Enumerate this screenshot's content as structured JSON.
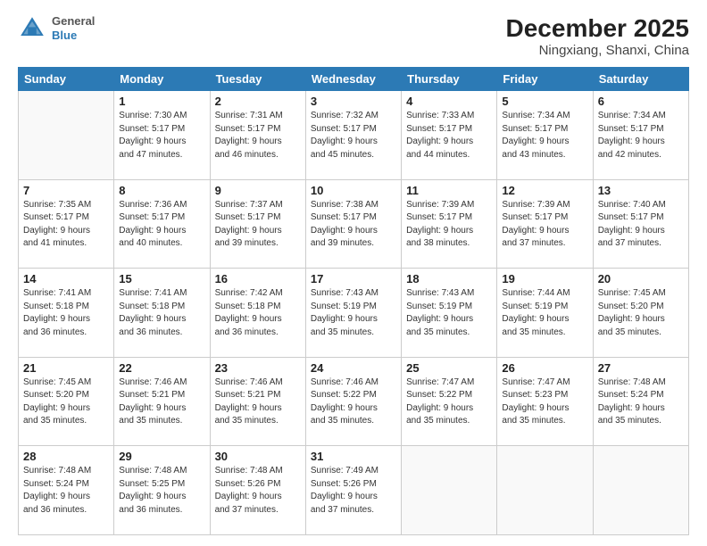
{
  "header": {
    "logo_line1": "General",
    "logo_line2": "Blue",
    "title": "December 2025",
    "subtitle": "Ningxiang, Shanxi, China"
  },
  "weekdays": [
    "Sunday",
    "Monday",
    "Tuesday",
    "Wednesday",
    "Thursday",
    "Friday",
    "Saturday"
  ],
  "weeks": [
    [
      {
        "day": "",
        "info": ""
      },
      {
        "day": "1",
        "info": "Sunrise: 7:30 AM\nSunset: 5:17 PM\nDaylight: 9 hours\nand 47 minutes."
      },
      {
        "day": "2",
        "info": "Sunrise: 7:31 AM\nSunset: 5:17 PM\nDaylight: 9 hours\nand 46 minutes."
      },
      {
        "day": "3",
        "info": "Sunrise: 7:32 AM\nSunset: 5:17 PM\nDaylight: 9 hours\nand 45 minutes."
      },
      {
        "day": "4",
        "info": "Sunrise: 7:33 AM\nSunset: 5:17 PM\nDaylight: 9 hours\nand 44 minutes."
      },
      {
        "day": "5",
        "info": "Sunrise: 7:34 AM\nSunset: 5:17 PM\nDaylight: 9 hours\nand 43 minutes."
      },
      {
        "day": "6",
        "info": "Sunrise: 7:34 AM\nSunset: 5:17 PM\nDaylight: 9 hours\nand 42 minutes."
      }
    ],
    [
      {
        "day": "7",
        "info": "Sunrise: 7:35 AM\nSunset: 5:17 PM\nDaylight: 9 hours\nand 41 minutes."
      },
      {
        "day": "8",
        "info": "Sunrise: 7:36 AM\nSunset: 5:17 PM\nDaylight: 9 hours\nand 40 minutes."
      },
      {
        "day": "9",
        "info": "Sunrise: 7:37 AM\nSunset: 5:17 PM\nDaylight: 9 hours\nand 39 minutes."
      },
      {
        "day": "10",
        "info": "Sunrise: 7:38 AM\nSunset: 5:17 PM\nDaylight: 9 hours\nand 39 minutes."
      },
      {
        "day": "11",
        "info": "Sunrise: 7:39 AM\nSunset: 5:17 PM\nDaylight: 9 hours\nand 38 minutes."
      },
      {
        "day": "12",
        "info": "Sunrise: 7:39 AM\nSunset: 5:17 PM\nDaylight: 9 hours\nand 37 minutes."
      },
      {
        "day": "13",
        "info": "Sunrise: 7:40 AM\nSunset: 5:17 PM\nDaylight: 9 hours\nand 37 minutes."
      }
    ],
    [
      {
        "day": "14",
        "info": "Sunrise: 7:41 AM\nSunset: 5:18 PM\nDaylight: 9 hours\nand 36 minutes."
      },
      {
        "day": "15",
        "info": "Sunrise: 7:41 AM\nSunset: 5:18 PM\nDaylight: 9 hours\nand 36 minutes."
      },
      {
        "day": "16",
        "info": "Sunrise: 7:42 AM\nSunset: 5:18 PM\nDaylight: 9 hours\nand 36 minutes."
      },
      {
        "day": "17",
        "info": "Sunrise: 7:43 AM\nSunset: 5:19 PM\nDaylight: 9 hours\nand 35 minutes."
      },
      {
        "day": "18",
        "info": "Sunrise: 7:43 AM\nSunset: 5:19 PM\nDaylight: 9 hours\nand 35 minutes."
      },
      {
        "day": "19",
        "info": "Sunrise: 7:44 AM\nSunset: 5:19 PM\nDaylight: 9 hours\nand 35 minutes."
      },
      {
        "day": "20",
        "info": "Sunrise: 7:45 AM\nSunset: 5:20 PM\nDaylight: 9 hours\nand 35 minutes."
      }
    ],
    [
      {
        "day": "21",
        "info": "Sunrise: 7:45 AM\nSunset: 5:20 PM\nDaylight: 9 hours\nand 35 minutes."
      },
      {
        "day": "22",
        "info": "Sunrise: 7:46 AM\nSunset: 5:21 PM\nDaylight: 9 hours\nand 35 minutes."
      },
      {
        "day": "23",
        "info": "Sunrise: 7:46 AM\nSunset: 5:21 PM\nDaylight: 9 hours\nand 35 minutes."
      },
      {
        "day": "24",
        "info": "Sunrise: 7:46 AM\nSunset: 5:22 PM\nDaylight: 9 hours\nand 35 minutes."
      },
      {
        "day": "25",
        "info": "Sunrise: 7:47 AM\nSunset: 5:22 PM\nDaylight: 9 hours\nand 35 minutes."
      },
      {
        "day": "26",
        "info": "Sunrise: 7:47 AM\nSunset: 5:23 PM\nDaylight: 9 hours\nand 35 minutes."
      },
      {
        "day": "27",
        "info": "Sunrise: 7:48 AM\nSunset: 5:24 PM\nDaylight: 9 hours\nand 35 minutes."
      }
    ],
    [
      {
        "day": "28",
        "info": "Sunrise: 7:48 AM\nSunset: 5:24 PM\nDaylight: 9 hours\nand 36 minutes."
      },
      {
        "day": "29",
        "info": "Sunrise: 7:48 AM\nSunset: 5:25 PM\nDaylight: 9 hours\nand 36 minutes."
      },
      {
        "day": "30",
        "info": "Sunrise: 7:48 AM\nSunset: 5:26 PM\nDaylight: 9 hours\nand 37 minutes."
      },
      {
        "day": "31",
        "info": "Sunrise: 7:49 AM\nSunset: 5:26 PM\nDaylight: 9 hours\nand 37 minutes."
      },
      {
        "day": "",
        "info": ""
      },
      {
        "day": "",
        "info": ""
      },
      {
        "day": "",
        "info": ""
      }
    ]
  ]
}
